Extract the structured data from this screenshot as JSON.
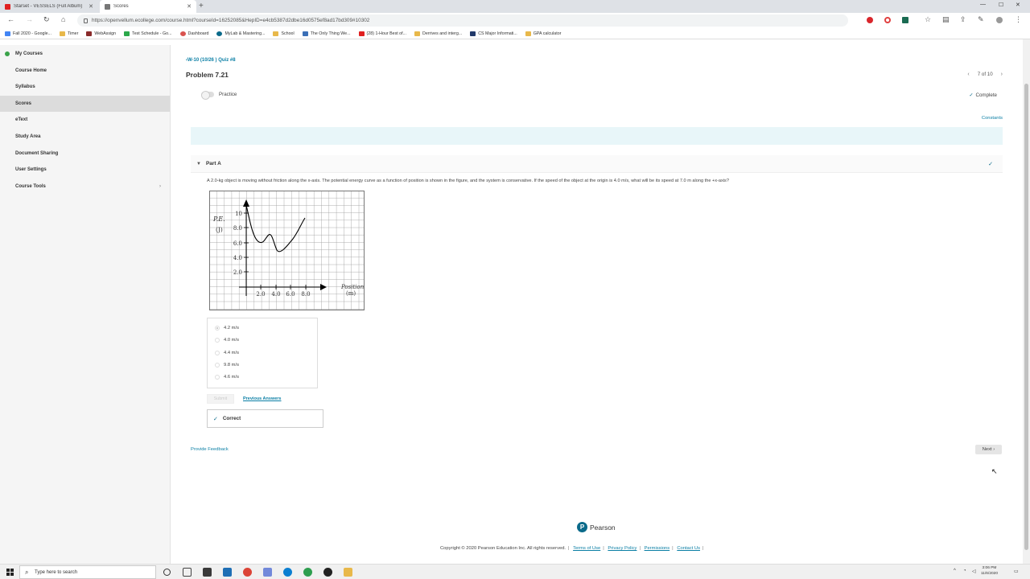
{
  "browser": {
    "tabs": [
      {
        "title": "Starset - VESSELS (Full Album)",
        "active": false
      },
      {
        "title": "Scores",
        "active": true
      }
    ],
    "url": "https://openvellum.ecollege.com/course.html?courseId=16252085&HepID=e4cb5387d2dbe16d0575ef8ad17bd309#10302",
    "bookmarks": [
      "Fall 2020 - Google...",
      "Timer",
      "WebAssign",
      "Test Schedule - Go...",
      "Dashboard",
      "MyLab & Mastering...",
      "School",
      "The Only Thing We...",
      "(28) 1-Hour Best of...",
      "Derrives and interg...",
      "CS Major Informati...",
      "GPA calculator"
    ]
  },
  "sidebar": {
    "items": [
      {
        "label": "My Courses"
      },
      {
        "label": "Course Home"
      },
      {
        "label": "Syllabus"
      },
      {
        "label": "Scores",
        "active": true
      },
      {
        "label": "eText"
      },
      {
        "label": "Study Area"
      },
      {
        "label": "Document Sharing"
      },
      {
        "label": "User Settings"
      },
      {
        "label": "Course Tools"
      }
    ]
  },
  "main": {
    "breadcrumb": "W-10 (10/26 ) Quiz #8",
    "problem_title": "Problem 7.21",
    "pager": "7 of 10",
    "practice_label": "Practice",
    "complete_label": "Complete",
    "constants_label": "Constants",
    "part_label": "Part A",
    "question": "A 2.0-kg object is moving without friction along the x-axis. The potential energy curve as a function of position is shown in the figure, and the system is conservative. If the speed of the object at the origin is 4.0 m/s, what will be its speed at 7.0 m along the +x-axis?",
    "figure": {
      "y_axis_label": "P.E.",
      "y_axis_unit": "(J)",
      "x_axis_label": "Position",
      "x_axis_unit": "(m)",
      "y_ticks": [
        "10",
        "8.0",
        "6.0",
        "4.0",
        "2.0"
      ],
      "x_ticks": [
        "2.0",
        "4.0",
        "6.0",
        "8.0"
      ]
    },
    "choices": [
      {
        "label": "4.2 m/s",
        "selected": true
      },
      {
        "label": "4.0 m/s",
        "selected": false
      },
      {
        "label": "4.4 m/s",
        "selected": false
      },
      {
        "label": "9.8 m/s",
        "selected": false
      },
      {
        "label": "4.6 m/s",
        "selected": false
      }
    ],
    "submit_label": "Submit",
    "previous_answers_label": "Previous Answers",
    "result_label": "Correct",
    "feedback_label": "Provide Feedback",
    "next_label": "Next"
  },
  "footer": {
    "brand": "Pearson",
    "copyright": "Copyright © 2020 Pearson Education Inc. All rights reserved.",
    "links": [
      "Terms of Use",
      "Privacy Policy",
      "Permissions",
      "Contact Us"
    ]
  },
  "taskbar": {
    "search_placeholder": "Type here to search",
    "time": "3:06 PM",
    "date": "11/6/2020"
  },
  "colors": {
    "accent": "#0b7fa5",
    "sidebar_bg": "#f5f5f5",
    "info_bar": "#e8f6f9"
  }
}
